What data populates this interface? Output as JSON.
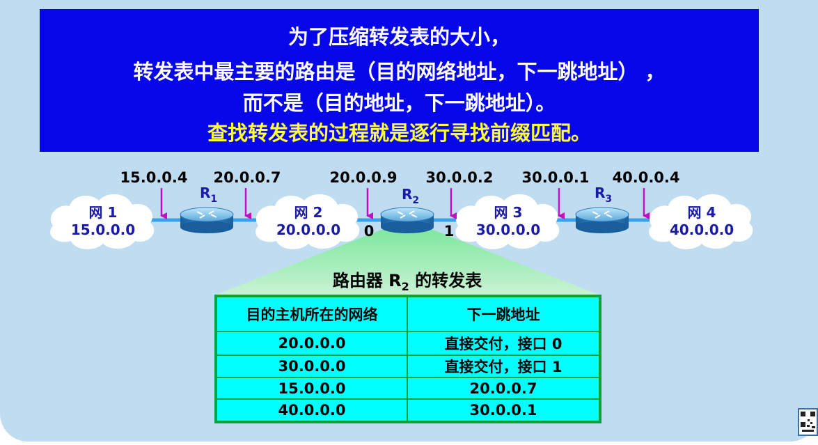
{
  "banner": {
    "line1": "为了压缩转发表的大小，",
    "line2": "转发表中最主要的路由是（目的网络地址，下一跳地址） ，",
    "line3": "而不是（目的地址，下一跳地址）。",
    "line4": "查找转发表的过程就是逐行寻找前缀匹配。"
  },
  "networks": [
    {
      "name": "网 1",
      "address": "15.0.0.0"
    },
    {
      "name": "网 2",
      "address": "20.0.0.0"
    },
    {
      "name": "网 3",
      "address": "30.0.0.0"
    },
    {
      "name": "网 4",
      "address": "40.0.0.0"
    }
  ],
  "routers": [
    {
      "name": "R",
      "sub": "1"
    },
    {
      "name": "R",
      "sub": "2"
    },
    {
      "name": "R",
      "sub": "3"
    }
  ],
  "interface_addresses": [
    "15.0.0.4",
    "20.0.0.7",
    "20.0.0.9",
    "30.0.0.2",
    "30.0.0.1",
    "40.0.0.4"
  ],
  "ports": [
    "0",
    "1"
  ],
  "forwarding_table": {
    "title_prefix": "路由器 R",
    "title_sub": "2",
    "title_suffix": " 的转发表",
    "headers": [
      "目的主机所在的网络",
      "下一跳地址"
    ],
    "rows": [
      [
        "20.0.0.0",
        "直接交付，接口 0"
      ],
      [
        "30.0.0.0",
        "直接交付，接口 1"
      ],
      [
        "15.0.0.0",
        "20.0.0.7"
      ],
      [
        "40.0.0.0",
        "30.0.0.1"
      ]
    ]
  },
  "colors": {
    "banner_bg": "#0707e9",
    "highlight": "#ffff3a",
    "arrow": "#c010c0",
    "table_bg": "#00ffff",
    "table_border": "#08a23a",
    "label_blue": "#1a1aa8"
  }
}
